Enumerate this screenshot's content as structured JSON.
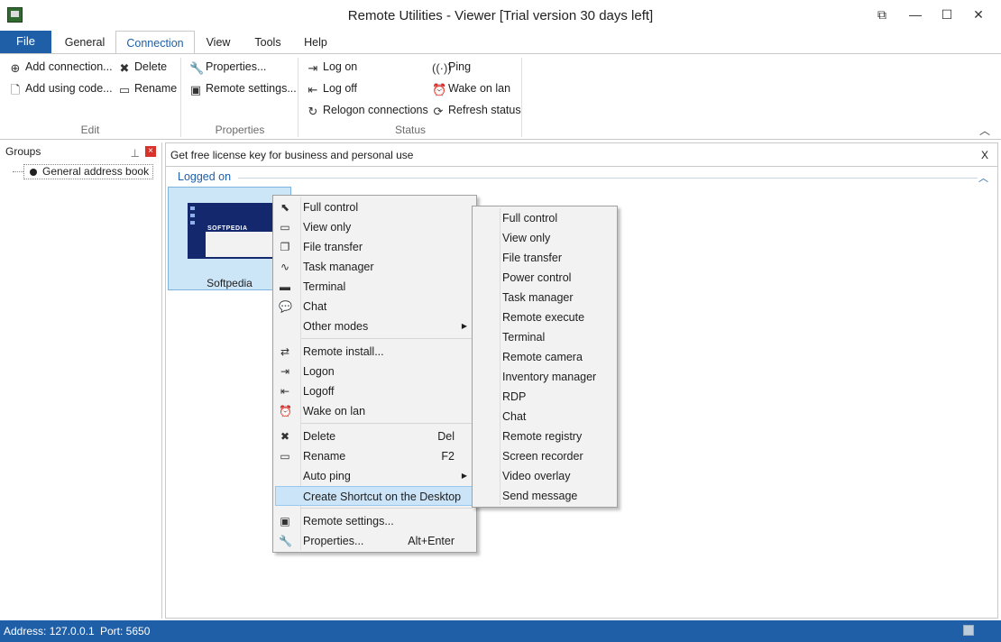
{
  "window": {
    "title": "Remote Utilities - Viewer [Trial version 30 days left]",
    "controls": [
      "⧉",
      "—",
      "☐",
      "✕"
    ]
  },
  "tabs": [
    "File",
    "General",
    "Connection",
    "View",
    "Tools",
    "Help"
  ],
  "active_tab": "Connection",
  "ribbon": {
    "edit": {
      "label": "Edit",
      "add_connection": "Add connection...",
      "add_using_code": "Add using code...",
      "delete": "Delete",
      "rename": "Rename"
    },
    "properties": {
      "label": "Properties",
      "properties": "Properties...",
      "remote_settings": "Remote settings..."
    },
    "status": {
      "label": "Status",
      "log_on": "Log on",
      "log_off": "Log off",
      "relogon": "Relogon connections",
      "ping": "Ping",
      "wake_on_lan": "Wake on lan",
      "refresh": "Refresh status"
    }
  },
  "groups": {
    "header": "Groups",
    "item": "General address book"
  },
  "main": {
    "banner": "Get free license key for business and personal use",
    "banner_close": "X",
    "section": "Logged on",
    "thumb_label": "Softpedia",
    "thumb_logo": "SOFTPEDIA"
  },
  "context_menu": {
    "items": [
      {
        "label": "Full control",
        "icon": "cursor-icon"
      },
      {
        "label": "View only",
        "icon": "monitor-icon"
      },
      {
        "label": "File transfer",
        "icon": "files-icon"
      },
      {
        "label": "Task manager",
        "icon": "pulse-icon"
      },
      {
        "label": "Terminal",
        "icon": "terminal-icon"
      },
      {
        "label": "Chat",
        "icon": "chat-icon"
      },
      {
        "label": "Other modes",
        "submenu": true
      },
      {
        "label": "Remote install...",
        "icon": "sync-icon"
      },
      {
        "label": "Logon",
        "icon": "logon-icon"
      },
      {
        "label": "Logoff",
        "icon": "logoff-icon"
      },
      {
        "label": "Wake on lan",
        "icon": "alarm-icon"
      },
      {
        "label": "Delete",
        "shortcut": "Del",
        "icon": "delete-icon"
      },
      {
        "label": "Rename",
        "shortcut": "F2",
        "icon": "rename-icon"
      },
      {
        "label": "Auto ping",
        "submenu": true
      },
      {
        "label": "Create Shortcut on the Desktop",
        "highlighted": true
      },
      {
        "label": "Remote settings...",
        "icon": "remote-settings-icon"
      },
      {
        "label": "Properties...",
        "shortcut": "Alt+Enter",
        "icon": "wrench-icon"
      }
    ]
  },
  "submenu": {
    "items": [
      "Full control",
      "View only",
      "File transfer",
      "Power control",
      "Task manager",
      "Remote execute",
      "Terminal",
      "Remote camera",
      "Inventory manager",
      "RDP",
      "Chat",
      "Remote registry",
      "Screen recorder",
      "Video overlay",
      "Send message"
    ]
  },
  "statusbar": {
    "address": "Address: 127.0.0.1",
    "port": "Port: 5650"
  },
  "colors": {
    "accent": "#1f5fa8",
    "selection": "#cce4f7",
    "close_red": "#d9322b"
  }
}
